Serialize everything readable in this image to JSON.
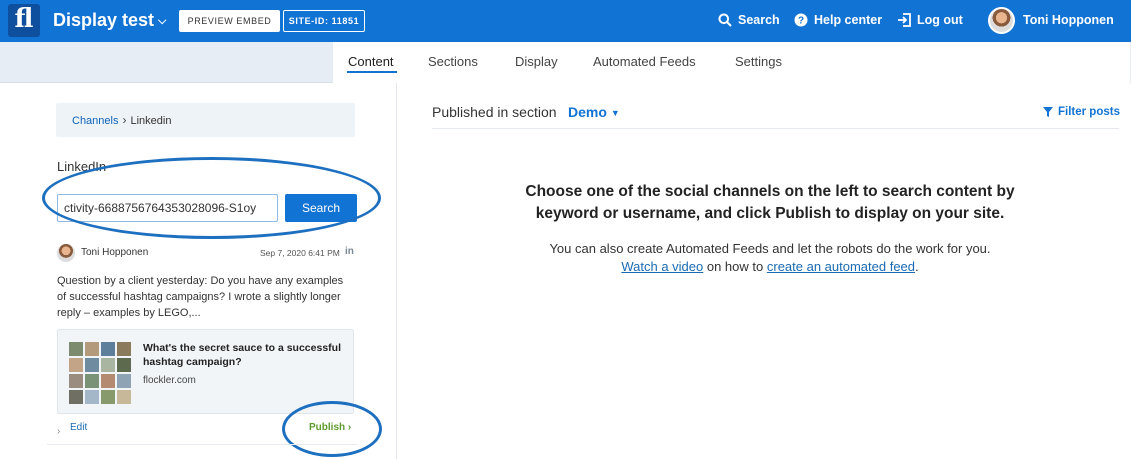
{
  "header": {
    "logo_text": "fl",
    "site_title": "Display test",
    "preview_embed_label": "PREVIEW EMBED",
    "site_id_label": "SITE-ID: 11851",
    "search_label": "Search",
    "help_label": "Help center",
    "logout_label": "Log out",
    "user_name": "Toni Hopponen",
    "accent_color": "#1173d4"
  },
  "tabs": [
    {
      "label": "Content",
      "active": true
    },
    {
      "label": "Sections",
      "active": false
    },
    {
      "label": "Display",
      "active": false
    },
    {
      "label": "Automated Feeds",
      "active": false
    },
    {
      "label": "Settings",
      "active": false
    }
  ],
  "left": {
    "breadcrumb": {
      "root": "Channels",
      "separator": "›",
      "current": "Linkedin"
    },
    "channel_heading": "LinkedIn",
    "search_value": "ctivity-6688756764353028096-S1oy",
    "search_button": "Search",
    "post": {
      "author": "Toni Hopponen",
      "date": "Sep 7, 2020 6:41 PM",
      "network_icon_text": "in",
      "text": "Question by a client yesterday: Do you have any examples of successful hashtag campaigns? I wrote a slightly longer reply – examples by LEGO,...",
      "card": {
        "title": "What's the secret sauce to a successful hashtag campaign?",
        "domain": "flockler.com"
      },
      "edit_label": "Edit",
      "publish_label": "Publish ›"
    }
  },
  "right": {
    "section_label": "Published in section",
    "section_value": "Demo",
    "filter_label": "Filter posts",
    "empty_heading": "Choose one of the social channels on the left to search content by keyword or username, and click Publish to display on your site.",
    "empty_sub_line1": "You can also create Automated Feeds and let the robots do the work for you.",
    "watch_video_link": "Watch a video",
    "empty_sub_mid": " on how to ",
    "create_feed_link": "create an automated feed",
    "empty_sub_end": "."
  }
}
